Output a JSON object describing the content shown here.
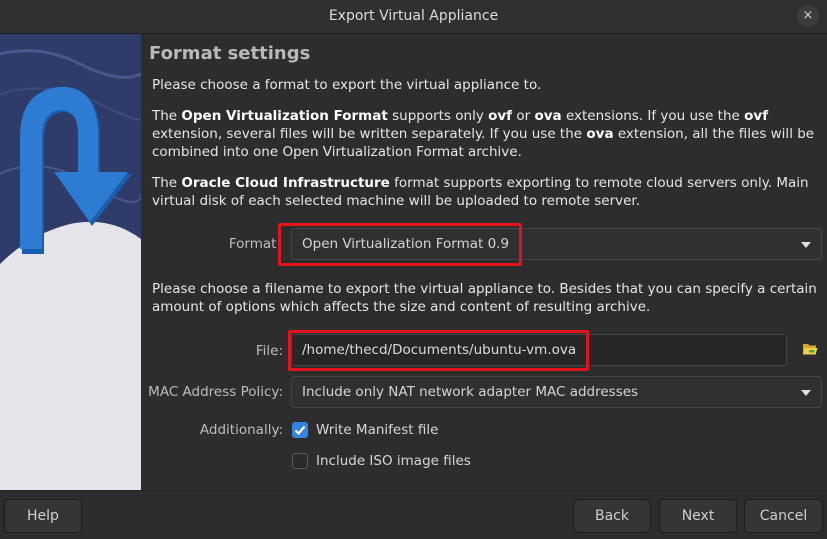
{
  "window": {
    "title": "Export Virtual Appliance",
    "close_glyph": "×"
  },
  "page": {
    "heading": "Format settings",
    "intro": "Please choose a format to export the virtual appliance to.",
    "ovf_para": {
      "p1": "The ",
      "b1": "Open Virtualization Format",
      "p2": " supports only ",
      "b2": "ovf",
      "p3": " or ",
      "b3": "ova",
      "p4": " extensions. If you use the ",
      "b4": "ovf",
      "p5": " extension, several files will be written separately. If you use the ",
      "b5": "ova",
      "p6": " extension, all the files will be combined into one Open Virtualization Format archive."
    },
    "oci_para": {
      "p1": "The ",
      "b1": "Oracle Cloud Infrastructure",
      "p2": " format supports exporting to remote cloud servers only. Main virtual disk of each selected machine will be uploaded to remote server."
    },
    "file_para": "Please choose a filename to export the virtual appliance to. Besides that you can specify a certain amount of options which affects the size and content of resulting archive."
  },
  "form": {
    "format_label": "Format:",
    "format_value": "Open Virtualization Format 0.9",
    "file_label": "File:",
    "file_value": "/home/thecd/Documents/ubuntu-vm.ova",
    "mac_label": "MAC Address Policy:",
    "mac_value": "Include only NAT network adapter MAC addresses",
    "additionally_label": "Additionally:",
    "write_manifest": {
      "label": "Write Manifest file",
      "checked": true
    },
    "include_iso": {
      "label": "Include ISO image files",
      "checked": false
    }
  },
  "buttons": {
    "help": "Help",
    "back": "Back",
    "next": "Next",
    "cancel": "Cancel"
  },
  "colors": {
    "highlight": "#e0141a",
    "checkbox_checked": "#3584e4",
    "wizard_arrow": "#2e7bd4"
  },
  "icons": {
    "folder": "folder-open-icon",
    "close": "close-icon",
    "dropdown": "chevron-down-icon",
    "checkmark": "checkmark-icon"
  }
}
